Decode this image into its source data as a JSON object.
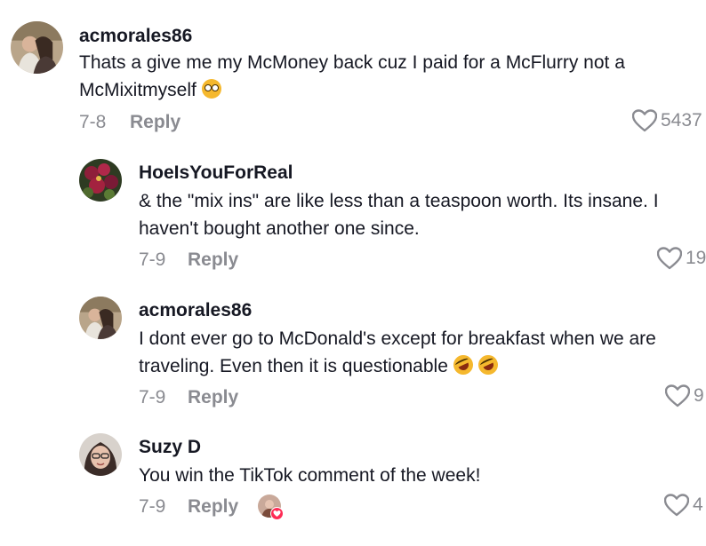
{
  "comments": [
    {
      "username": "acmorales86",
      "text": "Thats a give me my McMoney back cuz I paid for a McFlurry not a McMixitmyself",
      "emoji": "flushed-face",
      "date": "7-8",
      "reply_label": "Reply",
      "likes": "5437"
    },
    {
      "username": "HoeIsYouForReal",
      "text": "& the \"mix ins\" are like less than a teaspoon worth. Its insane. I haven't bought another one since.",
      "date": "7-9",
      "reply_label": "Reply",
      "likes": "19"
    },
    {
      "username": "acmorales86",
      "text": "I dont ever go to McDonald's except for breakfast when we are traveling. Even then it is questionable",
      "emoji": "rolling-on-floor-laughing",
      "date": "7-9",
      "reply_label": "Reply",
      "likes": "9"
    },
    {
      "username": "Suzy D",
      "text": "You win the TikTok comment of the week!",
      "date": "7-9",
      "reply_label": "Reply",
      "likes": "4",
      "liked_by_creator": true
    }
  ],
  "colors": {
    "text": "#161823",
    "muted": "#8a8b91",
    "accent": "#fe2c55"
  }
}
